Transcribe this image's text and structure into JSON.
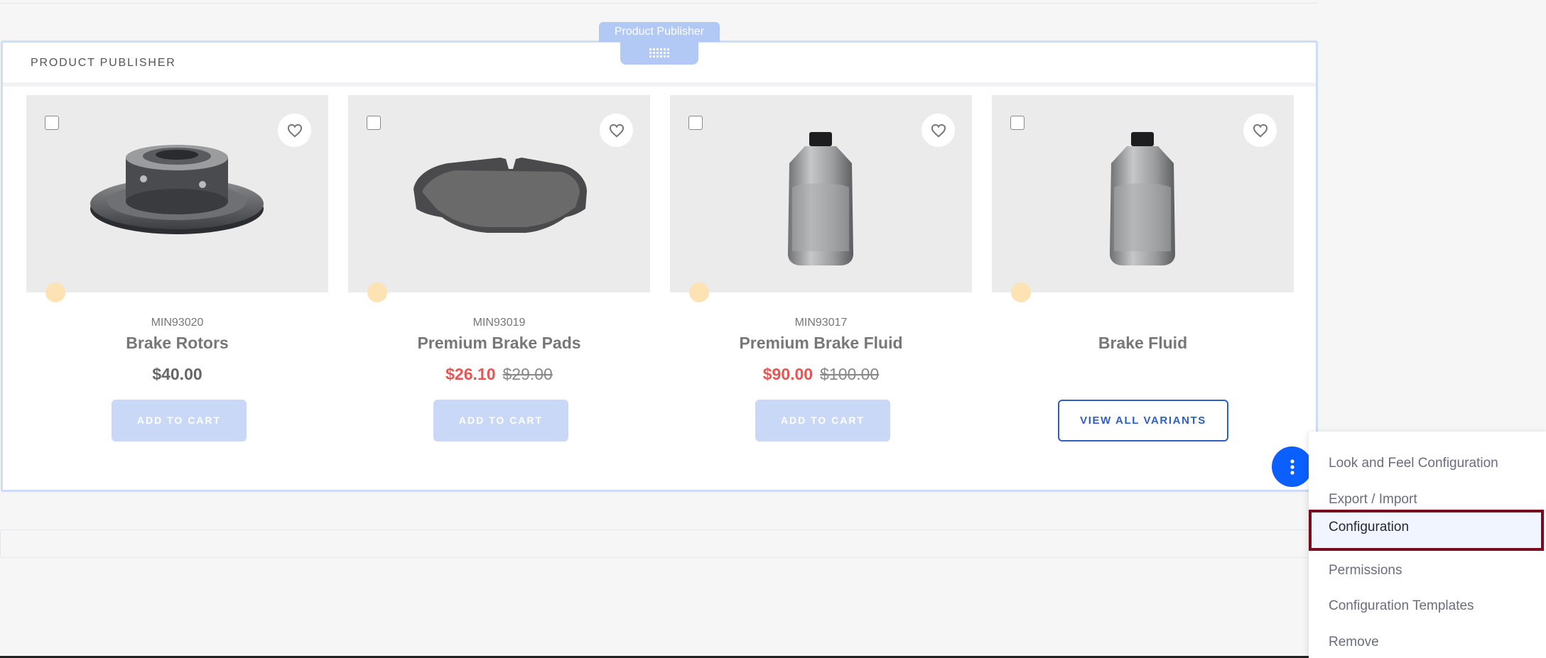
{
  "fragment": {
    "tag_label": "Product Publisher",
    "title": "PRODUCT PUBLISHER"
  },
  "products": [
    {
      "sku": "MIN93020",
      "name": "Brake Rotors",
      "price": "$40.00",
      "sale_price": "",
      "old_price": "",
      "button": "ADD TO CART",
      "image": "brake-rotor"
    },
    {
      "sku": "MIN93019",
      "name": "Premium Brake Pads",
      "price": "",
      "sale_price": "$26.10",
      "old_price": "$29.00",
      "button": "ADD TO CART",
      "image": "brake-pad"
    },
    {
      "sku": "MIN93017",
      "name": "Premium Brake Fluid",
      "price": "",
      "sale_price": "$90.00",
      "old_price": "$100.00",
      "button": "ADD TO CART",
      "image": "fluid-bottle"
    },
    {
      "sku": "",
      "name": "Brake Fluid",
      "price": "",
      "sale_price": "",
      "old_price": "",
      "button": "VIEW ALL VARIANTS",
      "image": "fluid-bottle"
    }
  ],
  "menu": {
    "items": [
      {
        "label": "Look and Feel Configuration"
      },
      {
        "label": "Export / Import"
      },
      {
        "label": "Configuration",
        "active": true
      },
      {
        "label": "Permissions"
      },
      {
        "label": "Configuration Templates"
      },
      {
        "label": "Remove"
      }
    ]
  },
  "colors": {
    "accent": "#0b5fff",
    "sale": "#e95454",
    "button_disabled": "#c8d8f6",
    "highlight_border": "#7a0b1e"
  },
  "icons": {
    "favorite": "heart-icon",
    "options": "vertical-ellipsis-icon",
    "drag": "drag-handle-icon"
  }
}
